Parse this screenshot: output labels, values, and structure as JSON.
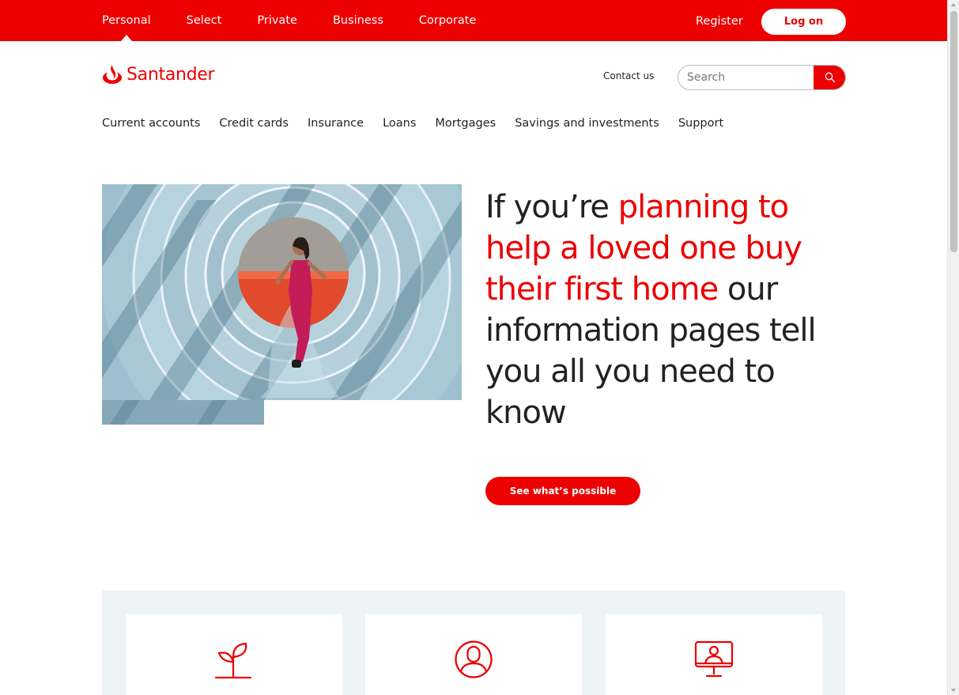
{
  "top_bar": {
    "segments": [
      {
        "label": "Personal",
        "active": true
      },
      {
        "label": "Select"
      },
      {
        "label": "Private"
      },
      {
        "label": "Business"
      },
      {
        "label": "Corporate"
      }
    ],
    "register_label": "Register",
    "logon_label": "Log on"
  },
  "header": {
    "brand": "Santander",
    "contact_label": "Contact us",
    "search_placeholder": "Search"
  },
  "nav": {
    "items": [
      "Current accounts",
      "Credit cards",
      "Insurance",
      "Loans",
      "Mortgages",
      "Savings and investments",
      "Support"
    ]
  },
  "hero": {
    "headline_pre": "If you’re ",
    "headline_highlight": "planning to help a loved one buy their first home",
    "headline_post": " our information pages tell you all you need to know",
    "cta_label": "See what’s possible"
  },
  "features": {
    "cards": [
      {
        "icon": "seedling-icon"
      },
      {
        "icon": "user-circle-icon"
      },
      {
        "icon": "computer-user-icon"
      }
    ]
  },
  "colors": {
    "brand_red": "#ec0000",
    "panel_bg": "#eef4f6"
  }
}
